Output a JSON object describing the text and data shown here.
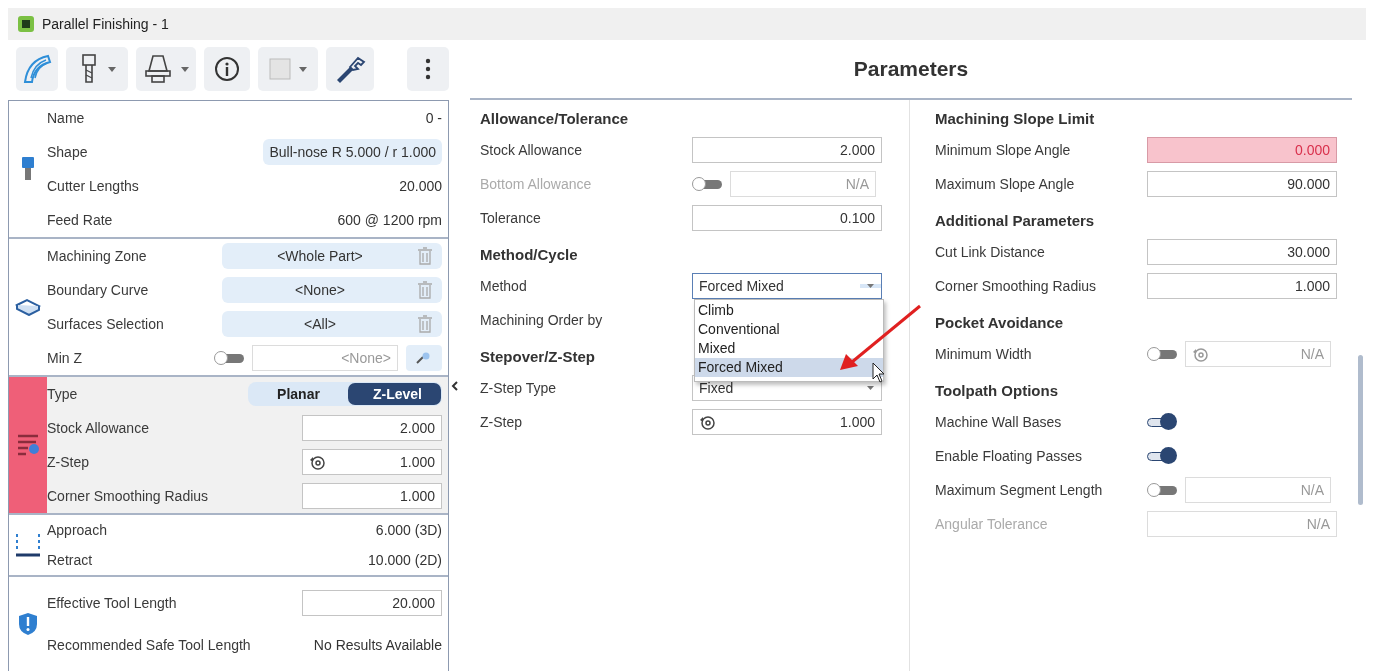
{
  "window": {
    "title": "Parallel Finishing - 1"
  },
  "toolbar": [
    {
      "kind": "toolpath",
      "dropdown": false
    },
    {
      "kind": "cutter",
      "dropdown": true
    },
    {
      "kind": "holder",
      "dropdown": true
    },
    {
      "kind": "info",
      "dropdown": false
    },
    {
      "kind": "pattern",
      "dropdown": true
    },
    {
      "kind": "wrench",
      "dropdown": false
    },
    {
      "kind": "more",
      "dropdown": false
    }
  ],
  "left_panel": {
    "sections": [
      {
        "kind": "cutter",
        "highlighted": false,
        "rows": [
          {
            "kind": "text",
            "label": "Name",
            "value": "0 -"
          },
          {
            "kind": "pill",
            "label": "Shape",
            "value": "Bull-nose R 5.000 / r 1.000"
          },
          {
            "kind": "text",
            "label": "Cutter Lengths",
            "value": "20.000"
          },
          {
            "kind": "text",
            "label": "Feed Rate",
            "value": "600 @ 1200 rpm"
          }
        ]
      },
      {
        "kind": "surface",
        "highlighted": false,
        "rows": [
          {
            "kind": "pill_delete",
            "label": "Machining Zone",
            "value": "<Whole Part>"
          },
          {
            "kind": "pill_delete",
            "label": "Boundary Curve",
            "value": "<None>"
          },
          {
            "kind": "pill_delete",
            "label": "Surfaces Selection",
            "value": "<All>"
          },
          {
            "kind": "toggle_field",
            "label": "Min Z",
            "on": false,
            "placeholder": "<None>"
          }
        ]
      },
      {
        "kind": "strategy",
        "highlighted": true,
        "rows": [
          {
            "kind": "segmented",
            "label": "Type",
            "options": [
              {
                "label": "Planar",
                "selected": false
              },
              {
                "label": "Z-Level",
                "selected": true
              }
            ]
          },
          {
            "kind": "field",
            "label": "Stock Allowance",
            "value": "2.000"
          },
          {
            "kind": "field_icon",
            "label": "Z-Step",
            "value": "1.000"
          },
          {
            "kind": "field",
            "label": "Corner Smoothing Radius",
            "value": "1.000"
          }
        ]
      },
      {
        "kind": "links",
        "highlighted": false,
        "rows": [
          {
            "kind": "text",
            "label": "Approach",
            "value": "6.000 (3D)"
          },
          {
            "kind": "text",
            "label": "Retract",
            "value": "10.000 (2D)"
          }
        ]
      },
      {
        "kind": "safety",
        "highlighted": false,
        "rows": [
          {
            "kind": "field",
            "label": "Effective Tool Length",
            "value": "20.000"
          },
          {
            "kind": "text",
            "label": "Recommended Safe Tool Length",
            "value": "No Results Available"
          }
        ]
      }
    ]
  },
  "parameters": {
    "title": "Parameters",
    "columns": [
      {
        "groups": [
          {
            "title": "Allowance/Tolerance",
            "rows": [
              {
                "kind": "field",
                "label": "Stock Allowance",
                "value": "2.000",
                "disabled": false,
                "error": false
              },
              {
                "kind": "toggle_field",
                "label": "Bottom Allowance",
                "on": false,
                "placeholder": "N/A",
                "disabled": true
              },
              {
                "kind": "field",
                "label": "Tolerance",
                "value": "0.100",
                "disabled": false,
                "error": false
              }
            ]
          },
          {
            "title": "Method/Cycle",
            "rows": [
              {
                "kind": "select",
                "label": "Method",
                "value": "Forced Mixed",
                "open": true,
                "disabled": false,
                "options": [
                  {
                    "label": "Climb",
                    "selected": false
                  },
                  {
                    "label": "Conventional",
                    "selected": false
                  },
                  {
                    "label": "Mixed",
                    "selected": false
                  },
                  {
                    "label": "Forced Mixed",
                    "selected": true
                  }
                ]
              },
              {
                "kind": "plain",
                "label": "Machining Order by",
                "disabled": false
              }
            ]
          },
          {
            "title": "Stepover/Z-Step",
            "rows": [
              {
                "kind": "select",
                "label": "Z-Step Type",
                "value": "Fixed",
                "open": false,
                "disabled": false
              },
              {
                "kind": "field_icon",
                "label": "Z-Step",
                "value": "1.000",
                "disabled": false
              }
            ]
          }
        ]
      },
      {
        "groups": [
          {
            "title": "Machining Slope Limit",
            "rows": [
              {
                "kind": "field",
                "label": "Minimum Slope Angle",
                "value": "0.000",
                "disabled": false,
                "error": true
              },
              {
                "kind": "field",
                "label": "Maximum Slope Angle",
                "value": "90.000",
                "disabled": false,
                "error": false
              }
            ]
          },
          {
            "title": "Additional Parameters",
            "rows": [
              {
                "kind": "field",
                "label": "Cut Link Distance",
                "value": "30.000",
                "disabled": false,
                "error": false
              },
              {
                "kind": "field",
                "label": "Corner Smoothing Radius",
                "value": "1.000",
                "disabled": false,
                "error": false
              }
            ]
          },
          {
            "title": "Pocket Avoidance",
            "rows": [
              {
                "kind": "toggle_field_icon",
                "label": "Minimum Width",
                "on": false,
                "placeholder": "N/A",
                "disabled": false
              }
            ]
          },
          {
            "title": "Toolpath Options",
            "rows": [
              {
                "kind": "toggle",
                "label": "Machine Wall Bases",
                "on": true,
                "disabled": false
              },
              {
                "kind": "toggle",
                "label": "Enable Floating Passes",
                "on": true,
                "disabled": false
              },
              {
                "kind": "toggle_field",
                "label": "Maximum Segment Length",
                "on": false,
                "placeholder": "N/A",
                "disabled": false
              },
              {
                "kind": "field",
                "label": "Angular Tolerance",
                "placeholder": "N/A",
                "disabled": true,
                "error": false
              }
            ]
          }
        ]
      }
    ]
  }
}
